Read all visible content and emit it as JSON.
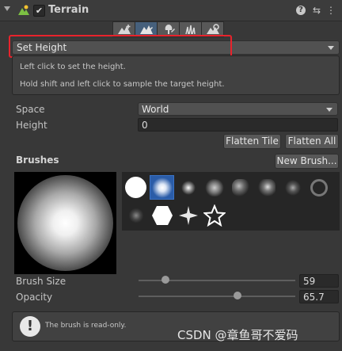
{
  "header": {
    "title": "Terrain",
    "enabled_check": "✔",
    "help_icon": "?",
    "settings_icon": "⇆",
    "more_icon": "⋮"
  },
  "tool_tabs": [
    {
      "name": "raise-lower",
      "selected": false
    },
    {
      "name": "paint-terrain",
      "selected": true
    },
    {
      "name": "place-trees",
      "selected": false
    },
    {
      "name": "paint-details",
      "selected": false
    },
    {
      "name": "terrain-settings",
      "selected": false
    }
  ],
  "paint_mode": {
    "value": "Set Height"
  },
  "help": {
    "line1": "Left click to set the height.",
    "line2": "Hold shift and left click to sample the target height."
  },
  "space": {
    "label": "Space",
    "value": "World"
  },
  "height": {
    "label": "Height",
    "value": "0"
  },
  "buttons": {
    "flatten_tile": "Flatten Tile",
    "flatten_all": "Flatten All",
    "new_brush": "New Brush..."
  },
  "brushes": {
    "title": "Brushes",
    "selected_index": 1
  },
  "brush_size": {
    "label": "Brush Size",
    "value": "59",
    "fraction": 0.17
  },
  "opacity": {
    "label": "Opacity",
    "value": "65.7",
    "fraction": 0.63
  },
  "info": {
    "icon": "!",
    "text": "The brush is read-only."
  },
  "watermark": "CSDN @章鱼哥不爱码",
  "colors": {
    "accent": "#2a5ca8",
    "highlight_box": "#e8232c"
  }
}
